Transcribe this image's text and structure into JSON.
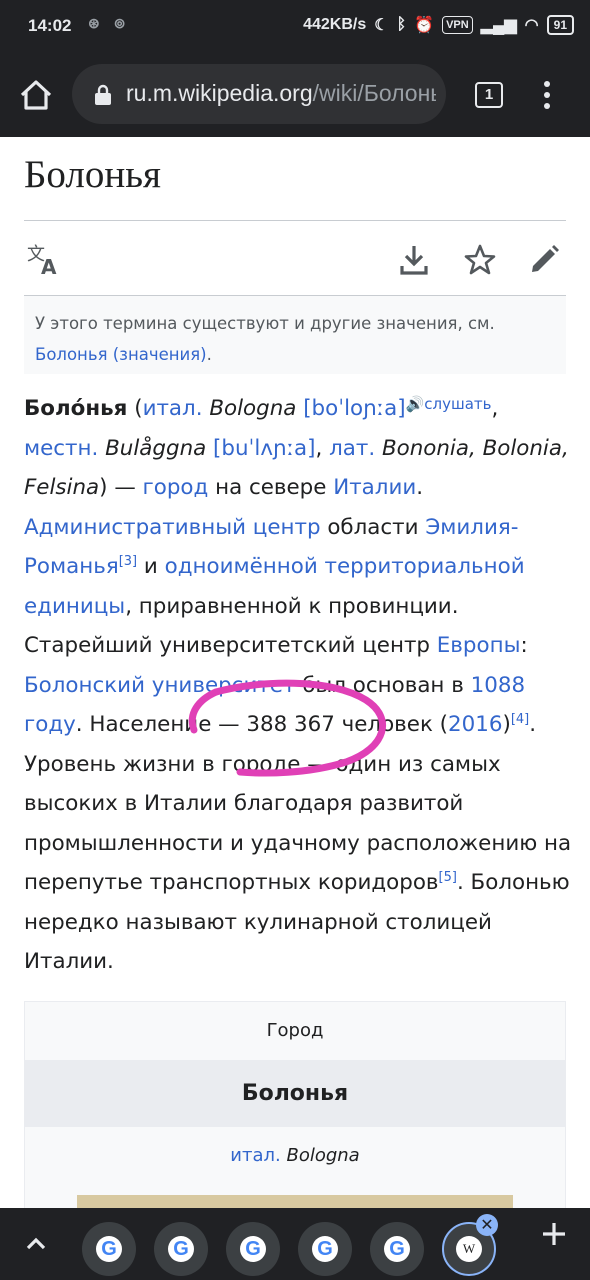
{
  "status_bar": {
    "time": "14:02",
    "network_speed": "442KB/s",
    "vpn_label": "VPN",
    "battery": "91"
  },
  "browser": {
    "url_host": "ru.m.wikipedia.org",
    "url_path": "/wiki/Болонья",
    "tab_count": "1"
  },
  "page": {
    "title": "Болонья",
    "hatnote_text": "У этого термина существуют и другие значения, см.",
    "hatnote_link": "Болонья (значения)",
    "hatnote_end": ".",
    "article": {
      "s1": "Боло́нья",
      "s2": " (",
      "s3": "итал.",
      "s4": " ",
      "s5": "Bologna",
      "s6": " ",
      "s7": "[boˈloɲːa]",
      "s8": "слушать",
      "s9": ", ",
      "s10": "местн.",
      "s11": " ",
      "s12": "Bulåggna",
      "s13": " ",
      "s14": "[buˈlʌɲːa]",
      "s15": ", ",
      "s16": "лат.",
      "s17": " ",
      "s18": "Bononia, Bolonia, Felsina",
      "s19": ") — ",
      "s20": "город",
      "s21": " на севере ",
      "s22": "Италии",
      "s23": ". ",
      "s24": "Административный центр",
      "s25": " области ",
      "s26": "Эмилия-Романья",
      "s27": "[3]",
      "s28": " и ",
      "s29": "одноимённой территориальной единицы",
      "s30": ", приравненной к провинции. Старейший университетский центр ",
      "s31": "Европы",
      "s32": ": ",
      "s33": "Болонский университет",
      "s34": " был основан в ",
      "s35": "1088 году",
      "s36": ". Население — 388 367 человек (",
      "s37": "2016",
      "s38": ")",
      "s39": "[4]",
      "s40": ". Уровень жизни в городе — один из самых высоких в Италии благодаря развитой промышленности и удачному расположению на перепутье транспортных коридоров",
      "s41": "[5]",
      "s42": ". Болонью нередко называют кулинарной столицей Италии."
    },
    "infobox": {
      "type": "Город",
      "name": "Болонья",
      "original_prefix": "итал.",
      "original_name": "Bologna"
    }
  },
  "icons": {
    "home": "home-icon",
    "lock": "lock-icon",
    "menu": "more-vert-icon",
    "translate": "translate-icon",
    "download": "download-icon",
    "star": "star-icon",
    "edit": "pencil-icon",
    "speaker": "speaker-icon",
    "chevron_up": "chevron-up-icon",
    "plus": "plus-icon",
    "close": "close-icon"
  },
  "colors": {
    "chrome_bg": "#202124",
    "link": "#3366cc",
    "annotation": "#e040b6"
  },
  "tab_strip": {
    "google_letter": "G",
    "wiki_letter": "W",
    "close_symbol": "✕"
  }
}
